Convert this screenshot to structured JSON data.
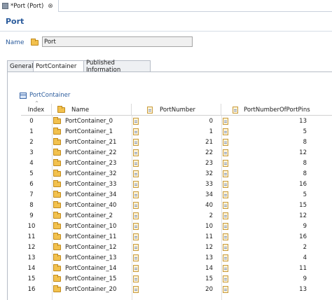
{
  "editor_tab": {
    "label": "*Port (Port)",
    "close": "⊗"
  },
  "page_title": "Port",
  "name_field": {
    "label": "Name",
    "value": "Port"
  },
  "inner_tabs": [
    "General",
    "PortContainer",
    "Published Information"
  ],
  "section_title": "PortContainer",
  "table": {
    "columns": [
      "Index",
      "Name",
      "PortNumber",
      "PortNumberOfPortPins"
    ],
    "rows": [
      {
        "index": "0",
        "name": "PortContainer_0",
        "port": "0",
        "pins": "13"
      },
      {
        "index": "1",
        "name": "PortContainer_1",
        "port": "1",
        "pins": "5"
      },
      {
        "index": "2",
        "name": "PortContainer_21",
        "port": "21",
        "pins": "8"
      },
      {
        "index": "3",
        "name": "PortContainer_22",
        "port": "22",
        "pins": "12"
      },
      {
        "index": "4",
        "name": "PortContainer_23",
        "port": "23",
        "pins": "8"
      },
      {
        "index": "5",
        "name": "PortContainer_32",
        "port": "32",
        "pins": "8"
      },
      {
        "index": "6",
        "name": "PortContainer_33",
        "port": "33",
        "pins": "16"
      },
      {
        "index": "7",
        "name": "PortContainer_34",
        "port": "34",
        "pins": "5"
      },
      {
        "index": "8",
        "name": "PortContainer_40",
        "port": "40",
        "pins": "15"
      },
      {
        "index": "9",
        "name": "PortContainer_2",
        "port": "2",
        "pins": "12"
      },
      {
        "index": "10",
        "name": "PortContainer_10",
        "port": "10",
        "pins": "9"
      },
      {
        "index": "11",
        "name": "PortContainer_11",
        "port": "11",
        "pins": "16"
      },
      {
        "index": "12",
        "name": "PortContainer_12",
        "port": "12",
        "pins": "2"
      },
      {
        "index": "13",
        "name": "PortContainer_13",
        "port": "13",
        "pins": "4"
      },
      {
        "index": "14",
        "name": "PortContainer_14",
        "port": "14",
        "pins": "11"
      },
      {
        "index": "15",
        "name": "PortContainer_15",
        "port": "15",
        "pins": "9"
      },
      {
        "index": "16",
        "name": "PortContainer_20",
        "port": "20",
        "pins": "13"
      }
    ]
  }
}
